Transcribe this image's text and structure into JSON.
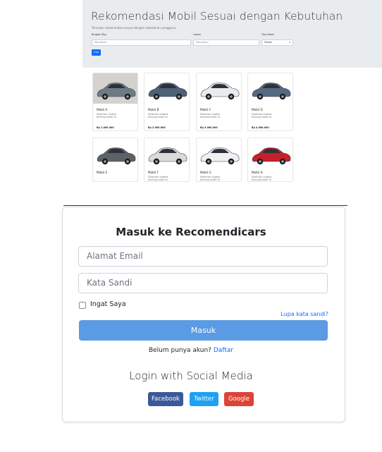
{
  "recommendation": {
    "title": "Rekomendasi Mobil Sesuai dengan Kebutuhan",
    "subtitle": "Temukan rekomendasi sesuai dengan kebutuhan pengguna",
    "filters": {
      "budget_label": "Budget (Rp)",
      "budget_placeholder": "Masukkan",
      "location_label": "Lokasi",
      "location_placeholder": "Masukkan",
      "type_label": "Tipe Mobil",
      "type_value": "Sedan"
    },
    "search_button": "Cari",
    "cars": [
      {
        "name": "Mobil A",
        "desc": "Deskripsi singkat tentang mobil ini.",
        "price": "Rp 1.000.000",
        "color": "#6e7b86"
      },
      {
        "name": "Mobil B",
        "desc": "Deskripsi singkat tentang mobil ini.",
        "price": "Rp 2.000.000",
        "color": "#4d6178"
      },
      {
        "name": "Mobil C",
        "desc": "Deskripsi singkat tentang mobil ini.",
        "price": "Rp 3.000.000",
        "color": "#e9ebee"
      },
      {
        "name": "Mobil D",
        "desc": "Deskripsi singkat tentang mobil ini.",
        "price": "Rp 4.000.000",
        "color": "#546a82"
      },
      {
        "name": "Mobil E",
        "desc": "",
        "price": "",
        "color": "#5d6266"
      },
      {
        "name": "Mobil F",
        "desc": "Deskripsi singkat tentang mobil ini.",
        "price": "",
        "color": "#d8dbde"
      },
      {
        "name": "Mobil G",
        "desc": "Deskripsi singkat tentang mobil ini.",
        "price": "",
        "color": "#eef0f2"
      },
      {
        "name": "Mobil H",
        "desc": "Deskripsi singkat tentang mobil ini.",
        "price": "",
        "color": "#c8202a"
      }
    ]
  },
  "login": {
    "title": "Masuk ke Recomendicars",
    "email_placeholder": "Alamat Email",
    "password_placeholder": "Kata Sandi",
    "remember_label": "Ingat Saya",
    "forgot_label": "Lupa kata sandi?",
    "submit_label": "Masuk",
    "signup_prompt": "Belum punya akun?",
    "signup_link": "Daftar",
    "social_title": "Login with Social Media",
    "social_buttons": [
      {
        "label": "Facebook",
        "color": "#3b5998"
      },
      {
        "label": "Twitter",
        "color": "#1da1f2"
      },
      {
        "label": "Google",
        "color": "#db4437"
      }
    ]
  },
  "colors": {
    "accent": "#0d6efd",
    "submit": "#5a9be3",
    "hero_bg": "#e9ecef"
  }
}
